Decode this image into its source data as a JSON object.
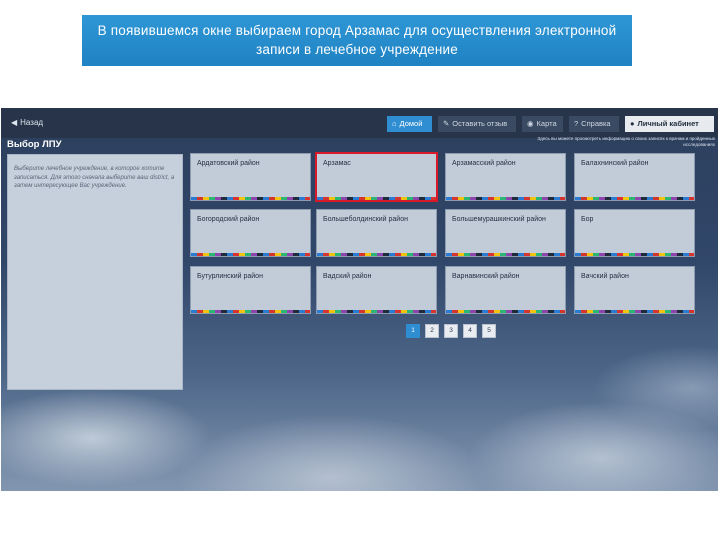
{
  "slide": {
    "caption": "В появившемся окне выбираем город Арзамас для осуществления электронной записи в лечебное учреждение"
  },
  "app": {
    "back_label": "Назад",
    "nav": {
      "home": "Домой",
      "feedback": "Оставить отзыв",
      "map": "Карта",
      "help": "Справка",
      "cabinet": "Личный кабинет"
    },
    "hint_note": "Здесь вы можете просмотреть информацию о своих записях к врачам и пройденных исследованиях",
    "section_title": "Выбор ЛПУ",
    "sidebar_text": "Выберите лечебное учреждение, в которое хотите записаться. Для этого сначала выберите ваш district, а затем интересующее Вас учреждение.",
    "districts": [
      [
        "Ардатовский район",
        "Арзамас",
        "Арзамасский район",
        "Балахнинский район"
      ],
      [
        "Богородский район",
        "Большеболдинский район",
        "Большемурашкинский район",
        "Бор"
      ],
      [
        "Бутурлинский район",
        "Вадский район",
        "Варнавинский район",
        "Вачский район"
      ]
    ],
    "selected_district": "Арзамас",
    "pages": [
      "1",
      "2",
      "3",
      "4",
      "5"
    ],
    "current_page": "1"
  },
  "colors": {
    "caption_bg": "#2589cc",
    "topbar_bg": "#27344a",
    "accent": "#2f8ed1",
    "selection": "#d7192a",
    "tile_bg": "#c2ccd9"
  },
  "icons": {
    "back": "arrow-left-icon",
    "home": "home-icon",
    "feedback": "comment-icon",
    "map": "globe-icon",
    "help": "question-icon",
    "cabinet": "user-icon"
  }
}
